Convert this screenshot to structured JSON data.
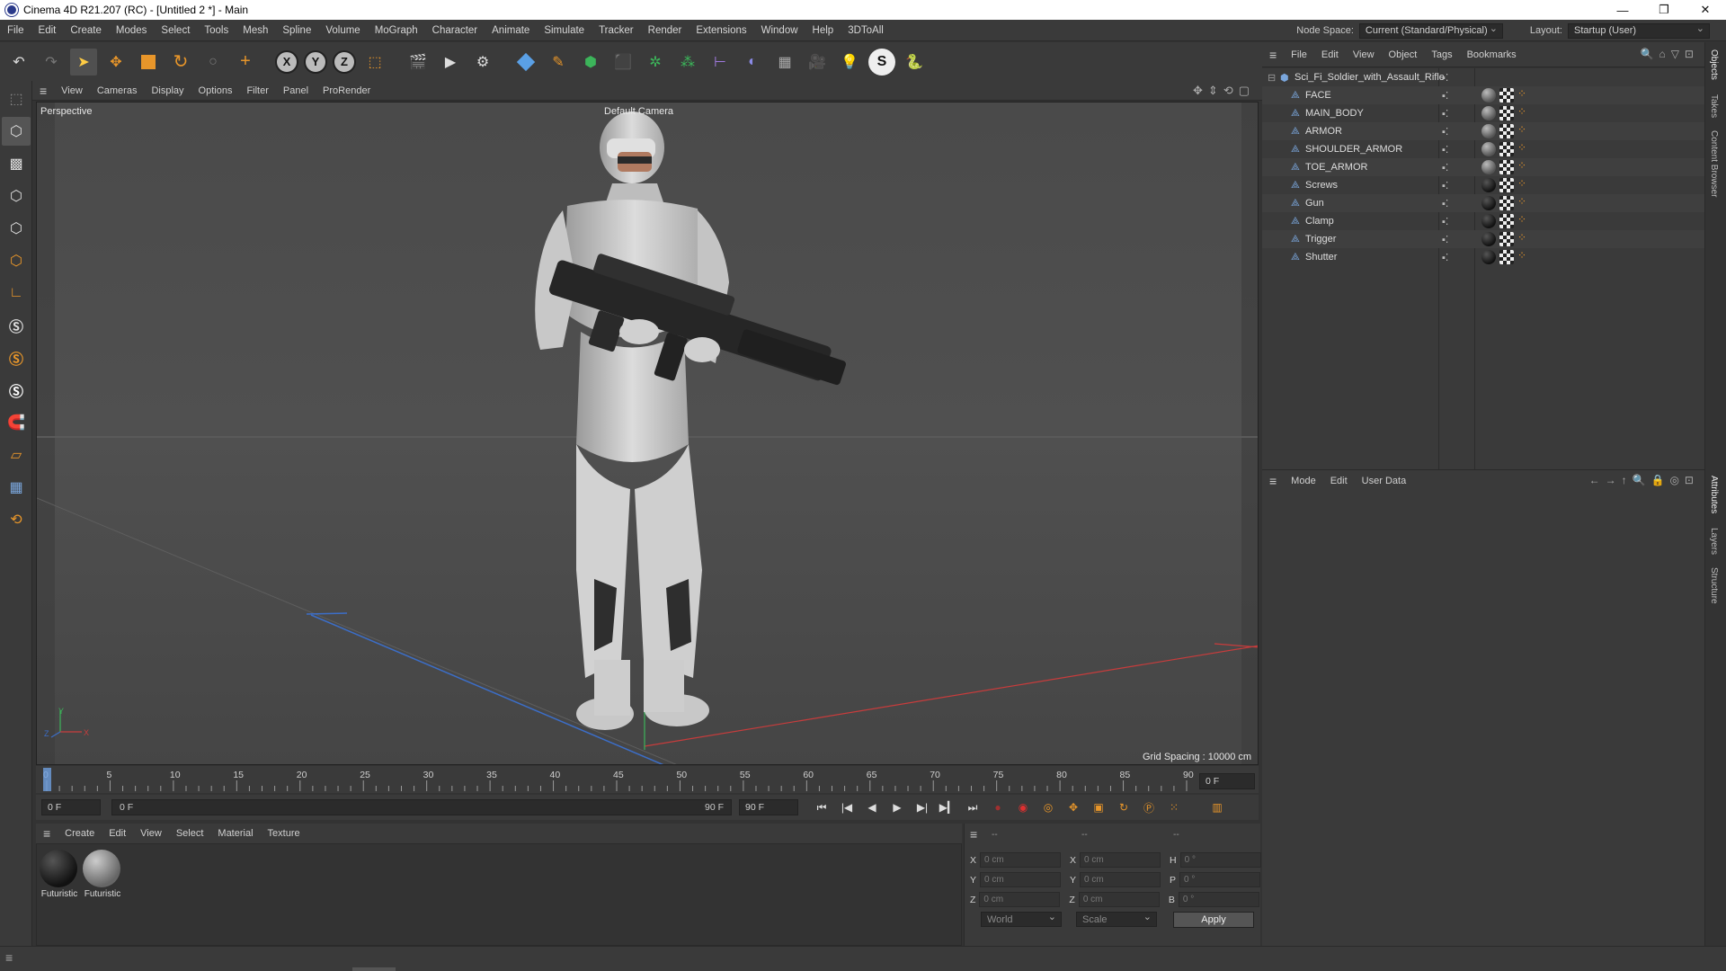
{
  "window": {
    "title": "Cinema 4D R21.207 (RC) - [Untitled 2 *] - Main",
    "minimize": "—",
    "restore": "❐",
    "close": "✕"
  },
  "menubar": {
    "items": [
      "File",
      "Edit",
      "Create",
      "Modes",
      "Select",
      "Tools",
      "Mesh",
      "Spline",
      "Volume",
      "MoGraph",
      "Character",
      "Animate",
      "Simulate",
      "Tracker",
      "Render",
      "Extensions",
      "Window",
      "Help",
      "3DToAll"
    ],
    "node_space_label": "Node Space:",
    "node_space_value": "Current (Standard/Physical)",
    "layout_label": "Layout:",
    "layout_value": "Startup (User)"
  },
  "toolbar": {
    "axis_x": "X",
    "axis_y": "Y",
    "axis_z": "Z"
  },
  "viewport": {
    "menu": [
      "View",
      "Cameras",
      "Display",
      "Options",
      "Filter",
      "Panel",
      "ProRender"
    ],
    "name": "Perspective",
    "camera": "Default Camera",
    "grid_spacing": "Grid Spacing : 10000 cm",
    "axis_y": "Y",
    "axis_z": "Z",
    "axis_x": "X"
  },
  "timeline": {
    "ticks": [
      "0",
      "5",
      "10",
      "15",
      "20",
      "25",
      "30",
      "35",
      "40",
      "45",
      "50",
      "55",
      "60",
      "65",
      "70",
      "75",
      "80",
      "85",
      "90"
    ],
    "current_frame": "0 F",
    "start_frame": "0 F",
    "range_start": "0 F",
    "range_end": "90 F",
    "end_frame": "90 F"
  },
  "material_manager": {
    "menu": [
      "Create",
      "Edit",
      "View",
      "Select",
      "Material",
      "Texture"
    ],
    "materials": [
      {
        "name": "Futuristic",
        "color": "#1e1e1e"
      },
      {
        "name": "Futuristic",
        "color": "#8a8a8a"
      }
    ]
  },
  "coordinates": {
    "header": [
      "--",
      "--",
      "--"
    ],
    "rows": [
      {
        "a_label": "X",
        "a_val": "0 cm",
        "b_label": "X",
        "b_val": "0 cm",
        "c_label": "H",
        "c_val": "0 °"
      },
      {
        "a_label": "Y",
        "a_val": "0 cm",
        "b_label": "Y",
        "b_val": "0 cm",
        "c_label": "P",
        "c_val": "0 °"
      },
      {
        "a_label": "Z",
        "a_val": "0 cm",
        "b_label": "Z",
        "b_val": "0 cm",
        "c_label": "B",
        "c_val": "0 °"
      }
    ],
    "world": "World",
    "scale": "Scale",
    "apply": "Apply"
  },
  "object_manager": {
    "menu": [
      "File",
      "Edit",
      "View",
      "Object",
      "Tags",
      "Bookmarks"
    ],
    "root": "Sci_Fi_Soldier_with_Assault_Rifle",
    "objects": [
      {
        "name": "FACE",
        "mat": "grey"
      },
      {
        "name": "MAIN_BODY",
        "mat": "grey"
      },
      {
        "name": "ARMOR",
        "mat": "grey"
      },
      {
        "name": "SHOULDER_ARMOR",
        "mat": "grey"
      },
      {
        "name": "TOE_ARMOR",
        "mat": "grey"
      },
      {
        "name": "Screws",
        "mat": "black"
      },
      {
        "name": "Gun",
        "mat": "black"
      },
      {
        "name": "Clamp",
        "mat": "black"
      },
      {
        "name": "Trigger",
        "mat": "black"
      },
      {
        "name": "Shutter",
        "mat": "black"
      }
    ]
  },
  "attribute_manager": {
    "menu": [
      "Mode",
      "Edit",
      "User Data"
    ]
  },
  "right_tabs": {
    "objects": "Objects",
    "takes": "Takes",
    "content_browser": "Content Browser",
    "attributes": "Attributes",
    "layers": "Layers",
    "structure": "Structure"
  },
  "colors": {
    "accent_orange": "#e8962a",
    "selection_blue": "#3a7bd5",
    "axis_red": "#c83c3c",
    "axis_green": "#3cb45a",
    "axis_blue": "#3c6ec8"
  }
}
